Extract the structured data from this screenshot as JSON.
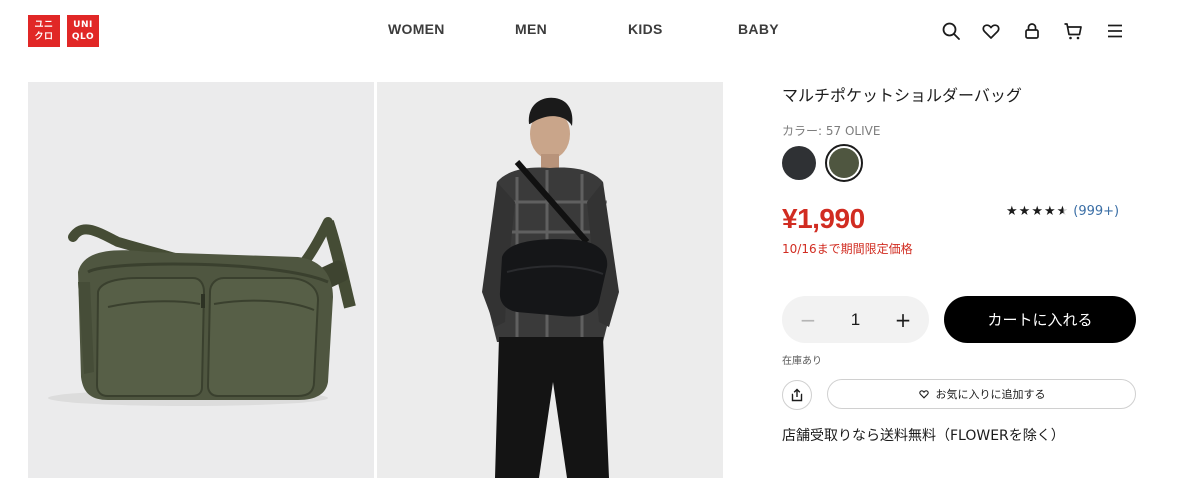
{
  "brand": {
    "logo_top_left": "ユニ",
    "logo_bottom_left": "クロ",
    "logo_top_right": "UNI",
    "logo_bottom_right": "QLO",
    "color": "#e12726"
  },
  "nav": {
    "items": [
      {
        "label": "WOMEN"
      },
      {
        "label": "MEN"
      },
      {
        "label": "KIDS"
      },
      {
        "label": "BABY"
      }
    ]
  },
  "header_icons": [
    "search-icon",
    "heart-icon",
    "account-icon",
    "cart-icon",
    "menu-icon"
  ],
  "product": {
    "title": "マルチポケットショルダーバッグ",
    "color_label": "カラー: 57 OLIVE",
    "swatches": [
      {
        "name": "navy",
        "color": "#2f3134",
        "selected": false
      },
      {
        "name": "olive",
        "color": "#4f5640",
        "selected": true
      }
    ],
    "price": "¥1,990",
    "promo": "10/16まで期間限定価格",
    "rating": {
      "stars": "★★★★★",
      "value": 4.5,
      "count": "(999+)"
    },
    "quantity": {
      "minus": "−",
      "value": "1",
      "plus": "+"
    },
    "add_to_cart": "カートに入れる",
    "stock": "在庫あり",
    "favorite": "お気に入りに追加する",
    "shipping": "店舗受取りなら送料無料（FLOWERを除く）"
  },
  "colors": {
    "price_red": "#d12c21",
    "link_blue": "#3a6ea5"
  }
}
